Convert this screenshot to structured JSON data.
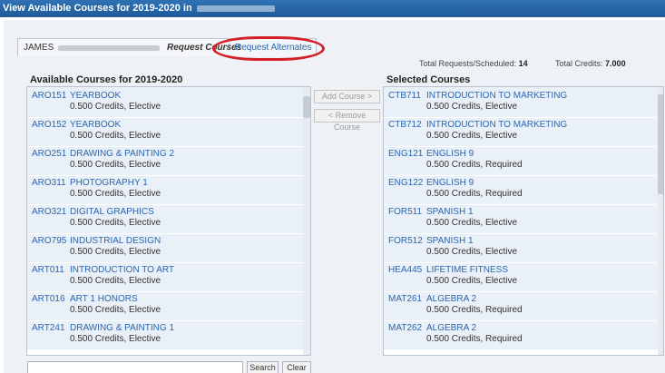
{
  "window": {
    "title": "View Available Courses for 2019-2020 in"
  },
  "tabs": {
    "student_first_name": "JAMES",
    "request_courses": "Request Courses",
    "separator": "/",
    "request_alternates": "Request Alternates"
  },
  "totals": {
    "requests_label": "Total Requests/Scheduled:",
    "requests_value": "14",
    "credits_label": "Total Credits:",
    "credits_value": "7.000"
  },
  "available": {
    "heading": "Available Courses for 2019-2020",
    "items": [
      {
        "code": "ARO151",
        "name": "YEARBOOK",
        "detail": "0.500 Credits,  Elective"
      },
      {
        "code": "ARO152",
        "name": "YEARBOOK",
        "detail": "0.500 Credits,  Elective"
      },
      {
        "code": "ARO251",
        "name": "DRAWING & PAINTING 2",
        "detail": "0.500 Credits,  Elective"
      },
      {
        "code": "ARO311",
        "name": "PHOTOGRAPHY 1",
        "detail": "0.500 Credits,  Elective"
      },
      {
        "code": "ARO321",
        "name": "DIGITAL GRAPHICS",
        "detail": "0.500 Credits,  Elective"
      },
      {
        "code": "ARO795",
        "name": "INDUSTRIAL DESIGN",
        "detail": "0.500 Credits,  Elective"
      },
      {
        "code": "ART011",
        "name": "INTRODUCTION TO ART",
        "detail": "0.500 Credits,  Elective"
      },
      {
        "code": "ART016",
        "name": "ART 1 HONORS",
        "detail": "0.500 Credits,  Elective"
      },
      {
        "code": "ART241",
        "name": "DRAWING & PAINTING 1",
        "detail": "0.500 Credits,  Elective"
      }
    ]
  },
  "selected": {
    "heading": "Selected Courses",
    "items": [
      {
        "code": "CTB711",
        "name": "INTRODUCTION TO MARKETING",
        "detail": "0.500 Credits,  Elective"
      },
      {
        "code": "CTB712",
        "name": "INTRODUCTION TO MARKETING",
        "detail": "0.500 Credits,  Elective"
      },
      {
        "code": "ENG121",
        "name": "ENGLISH 9",
        "detail": "0.500 Credits,  Required"
      },
      {
        "code": "ENG122",
        "name": "ENGLISH 9",
        "detail": "0.500 Credits,  Required"
      },
      {
        "code": "FOR511",
        "name": "SPANISH 1",
        "detail": "0.500 Credits,  Elective"
      },
      {
        "code": "FOR512",
        "name": "SPANISH 1",
        "detail": "0.500 Credits,  Elective"
      },
      {
        "code": "HEA445",
        "name": "LIFETIME FITNESS",
        "detail": "0.500 Credits,  Elective"
      },
      {
        "code": "MAT261",
        "name": "ALGEBRA 2",
        "detail": "0.500 Credits,  Required"
      },
      {
        "code": "MAT262",
        "name": "ALGEBRA 2",
        "detail": "0.500 Credits,  Required"
      }
    ]
  },
  "actions": {
    "add_course": "Add Course >",
    "remove_course": "< Remove Course",
    "search": "Search",
    "clear": "Clear"
  },
  "colors": {
    "title_bar": "#1f5a98",
    "link": "#2a66b0",
    "row_background": "#eaf0f7",
    "highlight_oval": "#d51f26"
  }
}
